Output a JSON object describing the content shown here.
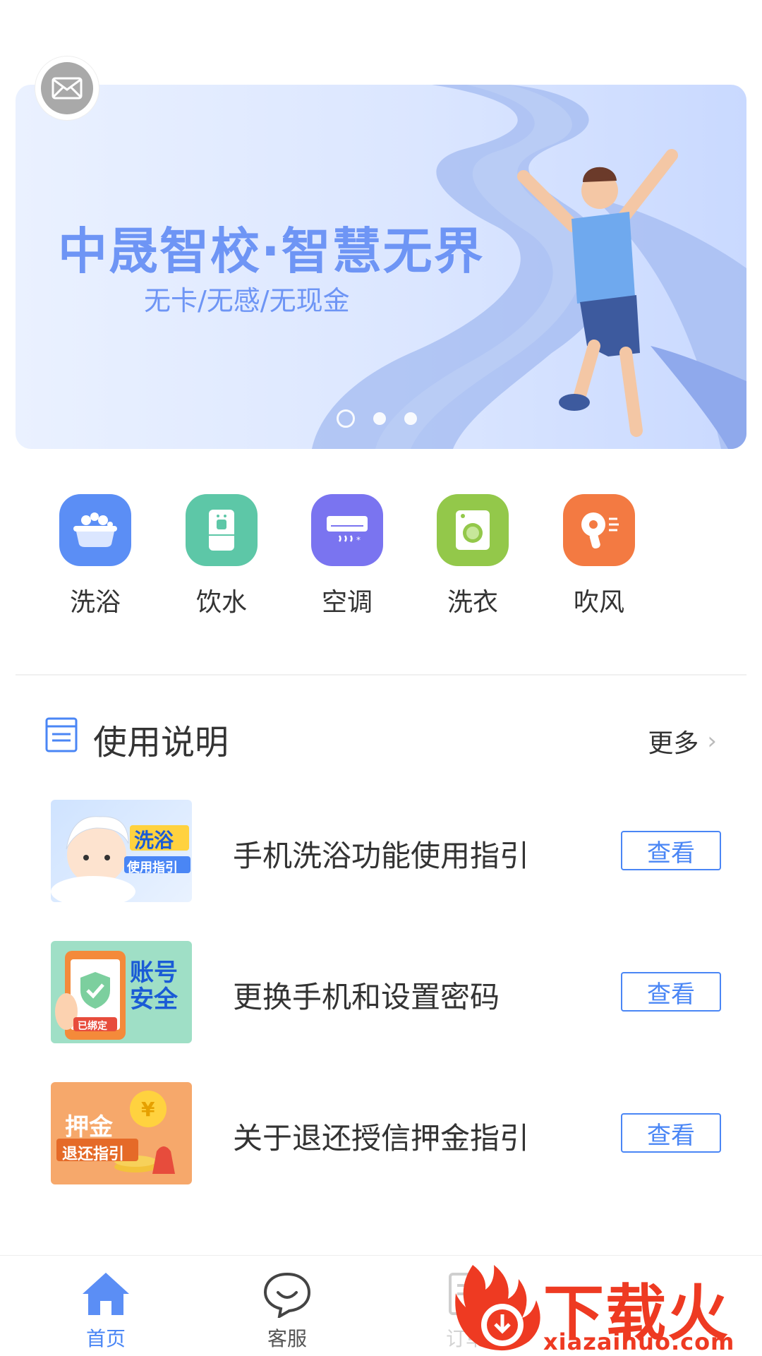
{
  "banner": {
    "title": "中晟智校·智慧无界",
    "subtitle": "无卡/无感/无现金",
    "slide_count": 3,
    "active_slide": 1
  },
  "services": [
    {
      "label": "洗浴",
      "icon": "bath-icon",
      "color": "#5b8ef5"
    },
    {
      "label": "饮水",
      "icon": "water-dispenser-icon",
      "color": "#5dc7a7"
    },
    {
      "label": "空调",
      "icon": "air-conditioner-icon",
      "color": "#7a74f0"
    },
    {
      "label": "洗衣",
      "icon": "washing-machine-icon",
      "color": "#93c84a"
    },
    {
      "label": "吹风",
      "icon": "hair-dryer-icon",
      "color": "#f37a42"
    }
  ],
  "instructions": {
    "title": "使用说明",
    "more": "更多",
    "items": [
      {
        "title": "手机洗浴功能使用指引",
        "button": "查看",
        "thumb_lines": [
          "洗浴",
          "使用指引"
        ]
      },
      {
        "title": "更换手机和设置密码",
        "button": "查看",
        "thumb_lines": [
          "账号",
          "安全",
          "已绑定"
        ]
      },
      {
        "title": "关于退还授信押金指引",
        "button": "查看",
        "thumb_lines": [
          "押金",
          "退还指引"
        ]
      }
    ]
  },
  "tabbar": {
    "items": [
      {
        "label": "首页",
        "icon": "home-icon",
        "active": true
      },
      {
        "label": "客服",
        "icon": "chat-icon",
        "active": false
      },
      {
        "label": "订单",
        "icon": "order-icon",
        "active": false
      }
    ]
  },
  "watermark": {
    "brand": "下载火",
    "url": "xiazaihuo.com"
  },
  "colors": {
    "accent": "#4a86f5",
    "banner_text": "#6e95f5",
    "watermark": "#ee3a22"
  }
}
